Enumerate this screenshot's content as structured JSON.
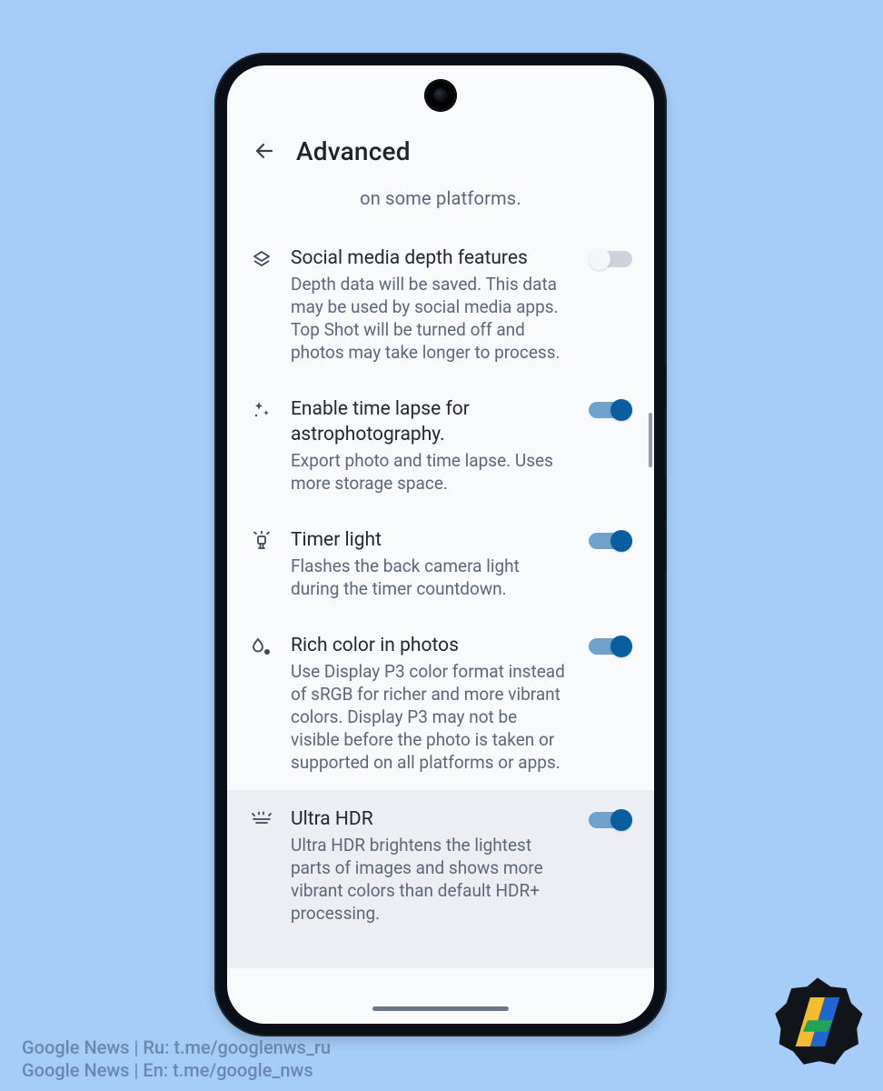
{
  "header": {
    "title": "Advanced"
  },
  "cutoff_text": "on some platforms.",
  "items": [
    {
      "icon": "layers-icon",
      "title": "Social media depth features",
      "sub": "Depth data will be saved. This data may be used by social media apps. Top Shot will be turned off and photos may take longer to process.",
      "on": false,
      "highlight": false
    },
    {
      "icon": "sparkle-icon",
      "title": "Enable time lapse for astrophotography.",
      "sub": "Export photo and time lapse. Uses more storage space.",
      "on": true,
      "highlight": false
    },
    {
      "icon": "timer-light-icon",
      "title": "Timer light",
      "sub": "Flashes the back camera light during the timer countdown.",
      "on": true,
      "highlight": false
    },
    {
      "icon": "color-drop-icon",
      "title": "Rich color in photos",
      "sub": "Use Display P3 color format instead of sRGB for richer and more vibrant colors. Display P3 may not be visible before the photo is taken or supported on all platforms or apps.",
      "on": true,
      "highlight": false
    },
    {
      "icon": "hdr-icon",
      "title": "Ultra HDR",
      "sub": "Ultra HDR brightens the lightest parts of images and shows more vibrant colors than default HDR+ processing.",
      "on": true,
      "highlight": true
    }
  ],
  "caption": {
    "line1": "Google News | Ru: t.me/googlenws_ru",
    "line2": "Google News | En: t.me/google_nws"
  },
  "colors": {
    "background": "#a6cdf8",
    "switch_on": "#0a5ea0"
  }
}
